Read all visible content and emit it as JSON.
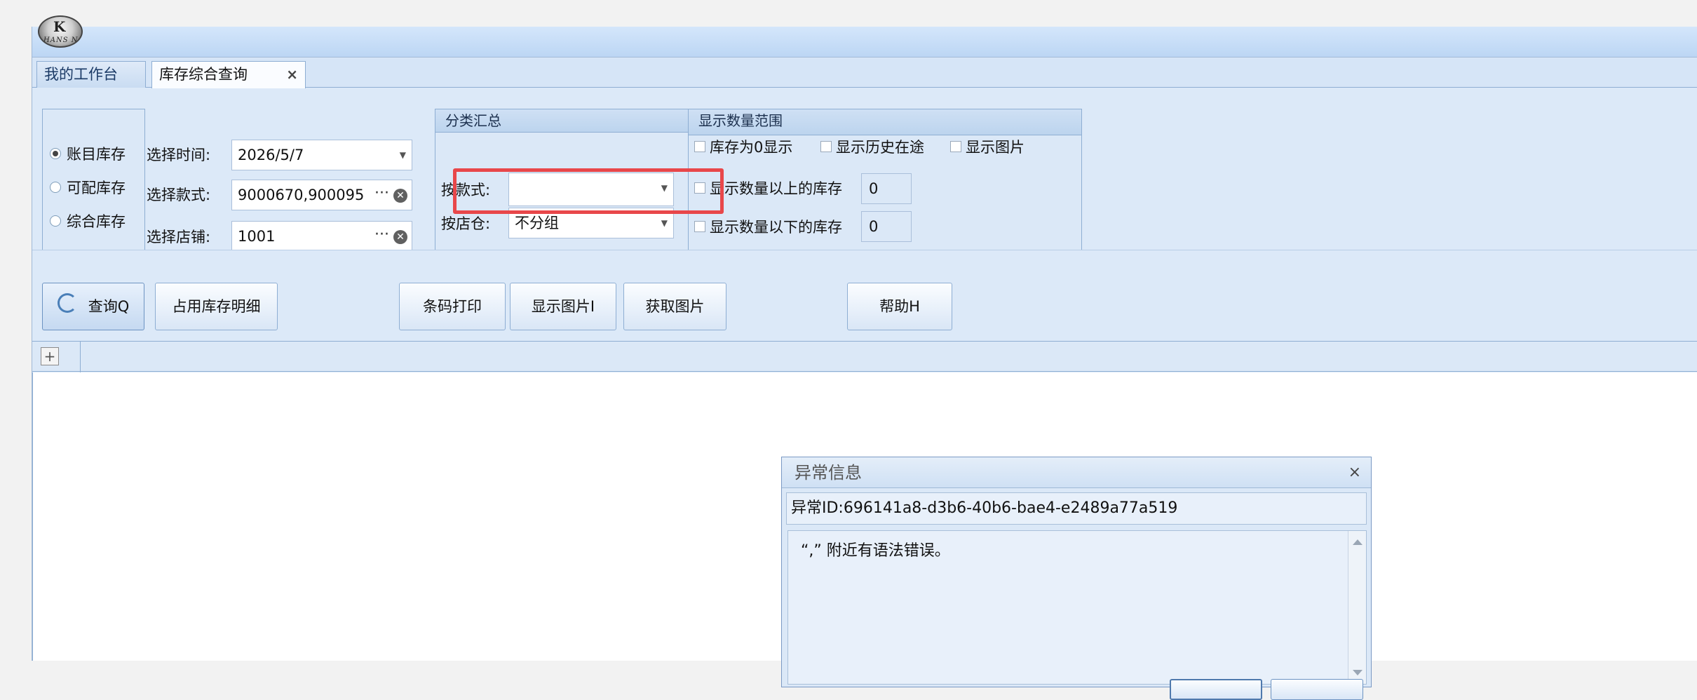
{
  "tabs": [
    {
      "label": "我的工作台"
    },
    {
      "label": "库存综合查询",
      "close": "×"
    }
  ],
  "stock_type": {
    "options": [
      "账目库存",
      "可配库存",
      "综合库存"
    ],
    "selected": "账目库存"
  },
  "filters": {
    "time_label": "选择时间:",
    "time_value": "2026/5/7",
    "style_label": "选择款式:",
    "style_value": "9000670,900095",
    "store_label": "选择店铺:",
    "store_value": "1001",
    "more": "···"
  },
  "group_summary": {
    "title": "分类汇总",
    "by_style_label": "按款式:",
    "by_style_value": "",
    "by_warehouse_label": "按店仓:",
    "by_warehouse_value": "不分组"
  },
  "quantity_range": {
    "title": "显示数量范围",
    "zero_label": "库存为0显示",
    "history_label": "显示历史在途",
    "image_label": "显示图片",
    "above_label": "显示数量以上的库存",
    "above_value": "0",
    "below_label": "显示数量以下的库存",
    "below_value": "0"
  },
  "toolbar": {
    "query": "查询Q",
    "occupied_detail": "占用库存明细",
    "barcode_print": "条码打印",
    "show_image": "显示图片I",
    "get_image": "获取图片",
    "help": "帮助H"
  },
  "grid": {
    "expand": "+"
  },
  "dialog": {
    "title": "异常信息",
    "close": "×",
    "exception_id": "异常ID:696141a8-d3b6-40b6-bae4-e2489a77a519",
    "message": "“,” 附近有语法错误。"
  },
  "logo_text": {
    "mark": "K",
    "name": "HANS N"
  },
  "colors": {
    "highlight": "#e8474a",
    "accent": "#8eaed3"
  }
}
